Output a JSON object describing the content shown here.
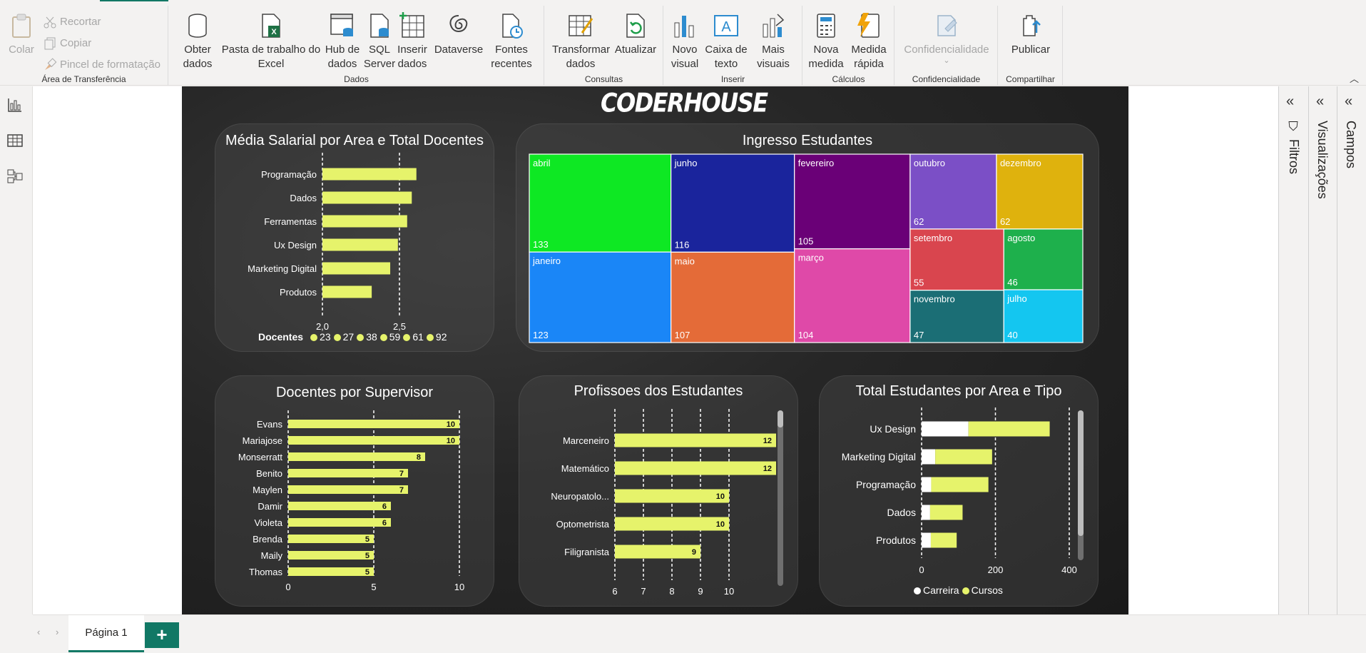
{
  "ribbon": {
    "clipboard": {
      "group_label": "Área de Transferência",
      "paste": "Colar",
      "cut": "Recortar",
      "copy": "Copiar",
      "format_painter": "Pincel de formatação"
    },
    "data": {
      "group_label": "Dados",
      "get_data": "Obter\ndados",
      "excel": "Pasta de trabalho do\nExcel",
      "data_hub": "Hub de\ndados",
      "sql": "SQL\nServer",
      "enter_data": "Inserir\ndados",
      "dataverse": "Dataverse",
      "recent": "Fontes\nrecentes"
    },
    "queries": {
      "group_label": "Consultas",
      "transform": "Transformar\ndados",
      "refresh": "Atualizar"
    },
    "insert": {
      "group_label": "Inserir",
      "new_visual": "Novo\nvisual",
      "text_box": "Caixa de\ntexto",
      "more_visuals": "Mais\nvisuais"
    },
    "calculations": {
      "group_label": "Cálculos",
      "new_measure": "Nova\nmedida",
      "quick_measure": "Medida\nrápida"
    },
    "sensitivity": {
      "group_label": "Confidencialidade",
      "sensitivity": "Confidencialidade"
    },
    "share": {
      "group_label": "Compartilhar",
      "publish": "Publicar"
    }
  },
  "panes": {
    "filters": "Filtros",
    "visualizations": "Visualizações",
    "fields": "Campos"
  },
  "bottom": {
    "page_tab": "Página 1",
    "add_page": "+"
  },
  "report": {
    "logo": "CODERHOUSE",
    "colors": {
      "bar": "#e6f36b",
      "white_bar": "#ffffff",
      "text": "#ffffff"
    }
  },
  "chart_data": [
    {
      "id": "salary",
      "type": "bar",
      "title": "Média Salarial por Area e Total Docentes",
      "categories": [
        "Programação",
        "Dados",
        "Ferramentas",
        "Ux Design",
        "Marketing Digital",
        "Produtos"
      ],
      "values": [
        2.61,
        2.58,
        2.55,
        2.49,
        2.44,
        2.32
      ],
      "xlim": [
        2.0,
        2.75
      ],
      "xticks": [
        "2,0",
        "2,5"
      ],
      "tick_values": [
        2.0,
        2.5
      ],
      "legend_title": "Docentes",
      "legend": [
        "23",
        "27",
        "38",
        "59",
        "61",
        "92"
      ]
    },
    {
      "id": "treemap",
      "type": "treemap",
      "title": "Ingresso Estudantes",
      "items": [
        {
          "label": "abril",
          "value": 133,
          "color": "#0ee823"
        },
        {
          "label": "janeiro",
          "value": 123,
          "color": "#1a86f7"
        },
        {
          "label": "junho",
          "value": 116,
          "color": "#1a249c"
        },
        {
          "label": "maio",
          "value": 107,
          "color": "#e46b38"
        },
        {
          "label": "fevereiro",
          "value": 105,
          "color": "#6a0077"
        },
        {
          "label": "março",
          "value": 104,
          "color": "#df49a8"
        },
        {
          "label": "outubro",
          "value": 62,
          "color": "#7b4fc6"
        },
        {
          "label": "dezembro",
          "value": 62,
          "color": "#dfb20d"
        },
        {
          "label": "setembro",
          "value": 55,
          "color": "#d9454e"
        },
        {
          "label": "novembro",
          "value": 47,
          "color": "#1b6e75"
        },
        {
          "label": "agosto",
          "value": 46,
          "color": "#1eb04c"
        },
        {
          "label": "julho",
          "value": 40,
          "color": "#14c6f0"
        }
      ]
    },
    {
      "id": "supervisor",
      "type": "bar",
      "title": "Docentes por Supervisor",
      "categories": [
        "Evans",
        "Mariajose",
        "Monserratt",
        "Benito",
        "Maylen",
        "Damir",
        "Violeta",
        "Brenda",
        "Maily",
        "Thomas"
      ],
      "values": [
        10,
        10,
        8,
        7,
        7,
        6,
        6,
        5,
        5,
        5
      ],
      "xlim": [
        0,
        10
      ],
      "xticks": [
        "0",
        "5",
        "10"
      ],
      "tick_values": [
        0,
        5,
        10
      ]
    },
    {
      "id": "professions",
      "type": "bar",
      "title": "Profissoes dos Estudantes",
      "categories": [
        "Marceneiro",
        "Matemático",
        "Neuropatolo...",
        "Optometrista",
        "Filigranista"
      ],
      "values": [
        12,
        12,
        10,
        10,
        9
      ],
      "xticks": [
        "6",
        "7",
        "8",
        "9",
        "10"
      ],
      "tick_values": [
        6,
        7,
        8,
        9,
        10
      ]
    },
    {
      "id": "area_type",
      "type": "bar",
      "title": "Total Estudantes por Area e Tipo",
      "categories": [
        "Ux Design",
        "Marketing Digital",
        "Programação",
        "Dados",
        "Produtos"
      ],
      "series": [
        {
          "name": "Carreira",
          "values": [
            127,
            37,
            26,
            23,
            25
          ],
          "color": "#ffffff"
        },
        {
          "name": "Cursos",
          "values": [
            220,
            154,
            155,
            88,
            70
          ],
          "color": "#e6f36b"
        }
      ],
      "xlim": [
        0,
        400
      ],
      "xticks": [
        "0",
        "200",
        "400"
      ],
      "tick_values": [
        0,
        200,
        400
      ]
    }
  ]
}
